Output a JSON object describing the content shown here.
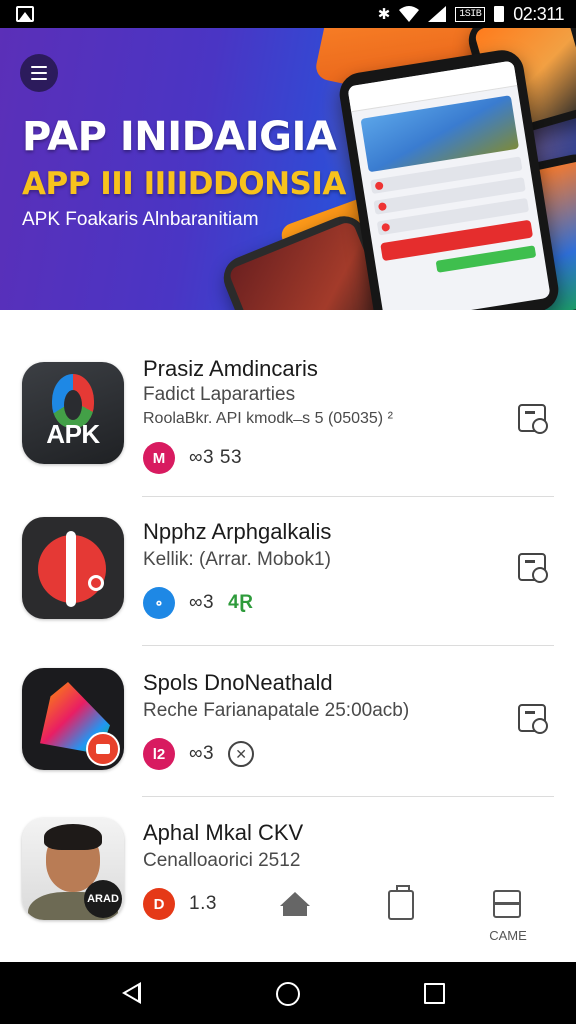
{
  "status_bar": {
    "battery_label": "1SIB",
    "time": "02:311"
  },
  "hero": {
    "title": "PAP INIDAIGIA",
    "subtitle": "APP III IIIIDDONSIA",
    "tagline": "APK Foakaris Alnbaranitiam"
  },
  "apps": [
    {
      "title": "Prasiz Amdincaris",
      "subtitle": "Fadict Lapararties",
      "meta": "RoolaBkr. API kmodk ̶ s 5 (05035) ²",
      "badge": "M",
      "stat": "∞3 53",
      "badge_color": "#d81b60",
      "icon_text": "APK"
    },
    {
      "title": "Npphz Arphgalkalis",
      "subtitle": "Kellik: (Arrar. Mobok1)",
      "badge": "∘",
      "stat": "∞3",
      "stat_extra": "4Ɽ",
      "badge_color": "#1e88e5"
    },
    {
      "title": "Spols DnoNeathald",
      "subtitle": "Reche Farianapatale 25:00acb)",
      "badge": "l2",
      "stat": "∞3",
      "badge_color": "#d81b60"
    },
    {
      "title": "Aphal Mkal CKV",
      "subtitle": "Cenalloaorici 2512",
      "badge": "D",
      "stat": "1.3",
      "badge_color": "#e53917",
      "icon_badge": "ARAD"
    }
  ],
  "tabbar": {
    "game_label": "CAME"
  }
}
